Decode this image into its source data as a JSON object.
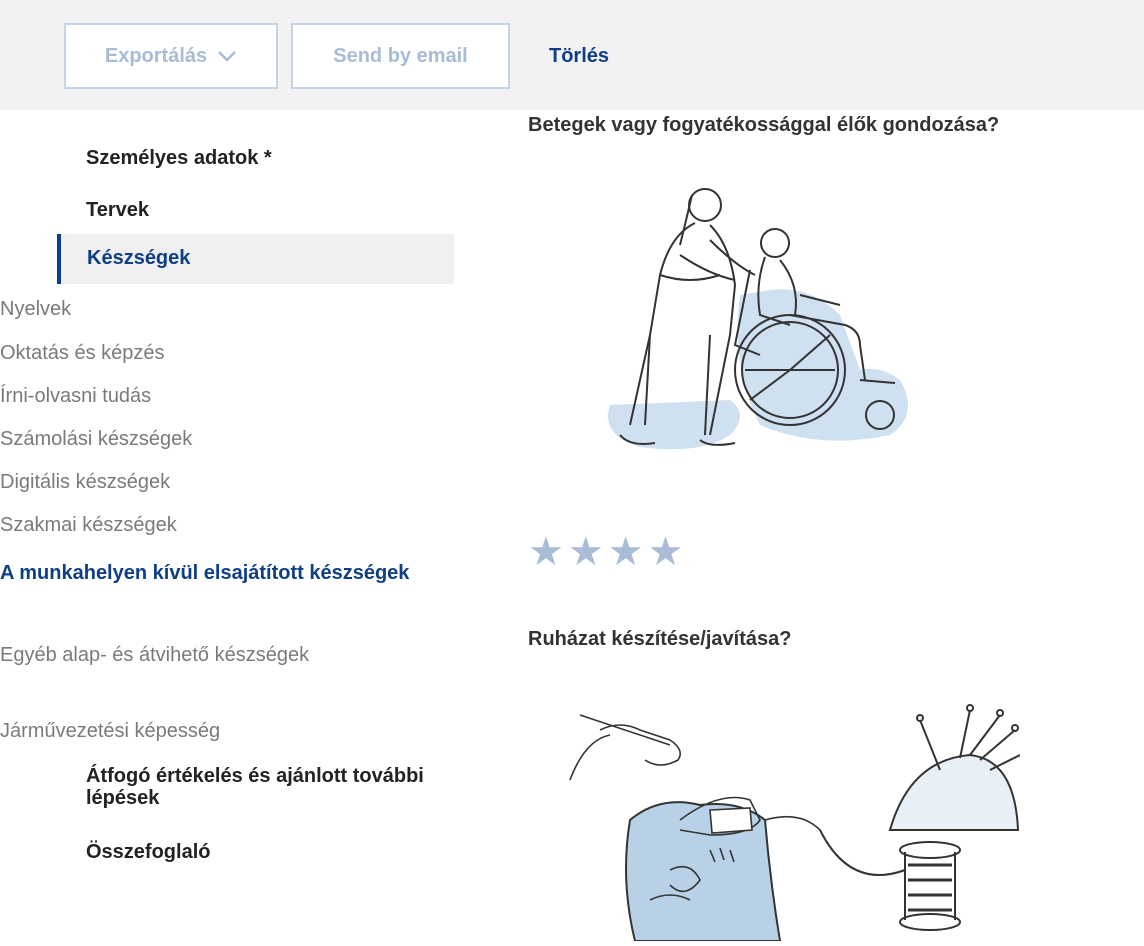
{
  "toolbar": {
    "export_label": "Exportálás",
    "email_label": "Send by email",
    "delete_label": "Törlés"
  },
  "sidebar": {
    "main_top": [
      {
        "label": "Személyes adatok *"
      },
      {
        "label": "Tervek"
      }
    ],
    "active": {
      "label": "Készségek"
    },
    "sub_items": [
      {
        "label": "Nyelvek"
      },
      {
        "label": "Oktatás és képzés"
      },
      {
        "label": "Írni-olvasni tudás"
      },
      {
        "label": "Számolási készségek"
      },
      {
        "label": "Digitális készségek"
      },
      {
        "label": "Szakmai készségek"
      },
      {
        "label": "A munkahelyen kívül elsajátított készségek"
      },
      {
        "label": "Egyéb alap- és átvihető készségek"
      },
      {
        "label": "Járművezetési képesség"
      }
    ],
    "main_bottom": [
      {
        "label": "Átfogó értékelés és ajánlott további lépések"
      },
      {
        "label": "Összefoglaló"
      }
    ]
  },
  "questions": [
    {
      "title": "Betegek vagy fogyatékossággal élők gondozása?",
      "rating": 4,
      "illustration": "wheelchair-care-illustration"
    },
    {
      "title": "Ruházat készítése/javítása?",
      "illustration": "sewing-illustration"
    }
  ],
  "icons": {
    "export_dropdown": "chevron-down-icon",
    "star": "star-icon"
  },
  "colors": {
    "accent": "#0e3f86",
    "disabled": "#a8bcd6",
    "toolbar_bg": "#f2f2f2"
  }
}
